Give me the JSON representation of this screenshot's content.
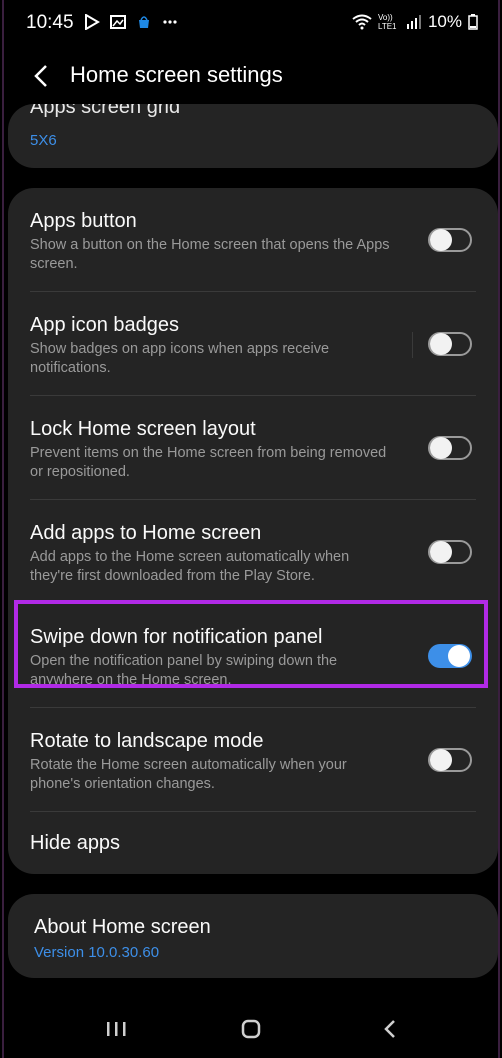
{
  "status_bar": {
    "time": "10:45",
    "network": "Vo)) LTE1",
    "battery": "10%"
  },
  "header": {
    "title": "Home screen settings"
  },
  "apps_grid": {
    "title": "Apps screen grid",
    "value": "5X6"
  },
  "settings": [
    {
      "title": "Apps button",
      "desc": "Show a button on the Home screen that opens the Apps screen.",
      "toggle": "off"
    },
    {
      "title": "App icon badges",
      "desc": "Show badges on app icons when apps receive notifications.",
      "toggle": "off"
    },
    {
      "title": "Lock Home screen layout",
      "desc": "Prevent items on the Home screen from being removed or repositioned.",
      "toggle": "off"
    },
    {
      "title": "Add apps to Home screen",
      "desc": "Add apps to the Home screen automatically when they're first downloaded from the Play Store.",
      "toggle": "off"
    },
    {
      "title": "Swipe down for notification panel",
      "desc": "Open the notification panel by swiping down the anywhere on the Home screen.",
      "toggle": "on"
    },
    {
      "title": "Rotate to landscape mode",
      "desc": "Rotate the Home screen automatically when your phone's orientation changes.",
      "toggle": "off"
    }
  ],
  "hide_apps": {
    "title": "Hide apps"
  },
  "about": {
    "title": "About Home screen",
    "version": "Version 10.0.30.60"
  },
  "colors": {
    "accent": "#3d8fe8",
    "highlight": "#b12ae6",
    "card": "#242424"
  },
  "icons": [
    "back-icon",
    "recents-icon",
    "home-icon",
    "nav-back-icon",
    "wifi-icon",
    "signal-icon",
    "battery-icon"
  ]
}
